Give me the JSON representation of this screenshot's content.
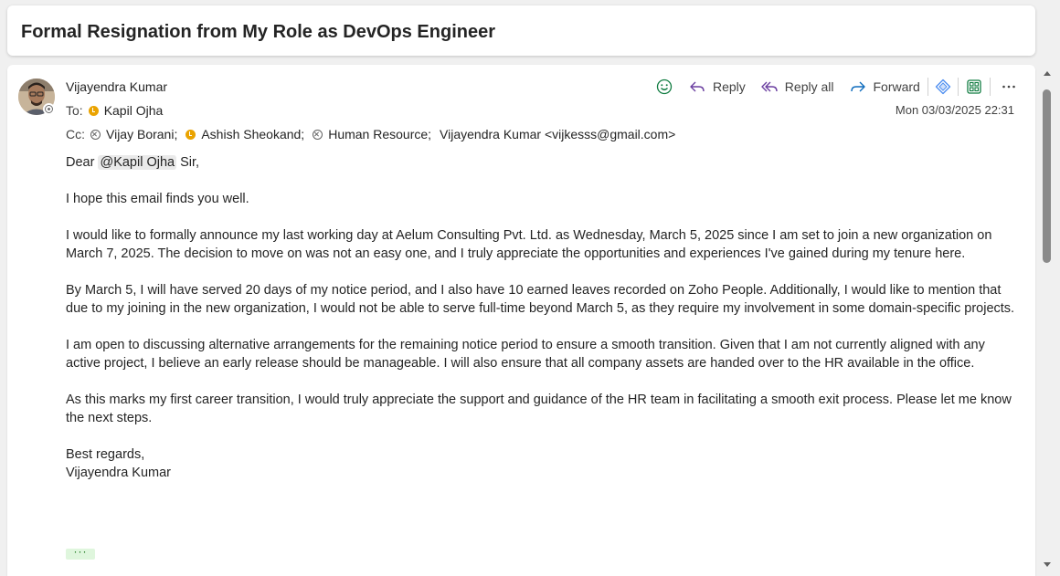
{
  "email": {
    "subject": "Formal Resignation from My Role as DevOps Engineer",
    "sender": "Vijayendra Kumar",
    "to_label": "To:",
    "to": [
      {
        "name": "Kapil Ojha",
        "status": "away"
      }
    ],
    "cc_label": "Cc:",
    "cc": [
      {
        "name": "Vijay Borani;",
        "status": "offline"
      },
      {
        "name": "Ashish Sheokand;",
        "status": "away"
      },
      {
        "name": "Human Resource;",
        "status": "offline"
      },
      {
        "name": "Vijayendra Kumar <vijkesss@gmail.com>",
        "status": "none"
      }
    ],
    "date": "Mon 03/03/2025 22:31",
    "body": {
      "greeting_prefix": "Dear ",
      "greeting_mention": "@Kapil Ojha",
      "greeting_suffix": " Sir,",
      "paragraphs": [
        "I hope this email finds you well.",
        "I would like to formally announce my last working day at Aelum Consulting Pvt. Ltd. as Wednesday, March 5, 2025 since I am set to join a new organization on March 7, 2025. The decision to move on was not an easy one, and I truly appreciate the opportunities and experiences I've gained during my tenure here.",
        "By March 5, I will have served 20 days of my notice period, and I also have 10 earned leaves recorded on Zoho People. Additionally, I would like to mention that due to my joining in the new organization, I would not be able to serve full-time beyond March 5, as they require my involvement in some domain-specific projects.",
        "I am open to discussing alternative arrangements for the remaining notice period to ensure a smooth transition. Given that I am not currently aligned with any active project, I believe an early release should be manageable. I will also ensure that all company assets are handed over to the HR available in the office.",
        "As this marks my first career transition, I would truly appreciate the support and guidance of the HR team in facilitating a smooth exit process. Please let me know the next steps."
      ],
      "closing": "Best regards,",
      "signature": "Vijayendra Kumar"
    },
    "more_indicator": "···"
  },
  "actions": {
    "reply_label": "Reply",
    "reply_all_label": "Reply all",
    "forward_label": "Forward",
    "icons": [
      "emoji-icon",
      "reply-icon",
      "reply-all-icon",
      "forward-icon",
      "copilot-icon",
      "apps-icon",
      "more-icon"
    ]
  },
  "colors": {
    "accent_blue": "#0f6cbd",
    "reply_purple": "#6b3fa0",
    "apps_green": "#107c41",
    "away_yellow": "#eaa300"
  }
}
